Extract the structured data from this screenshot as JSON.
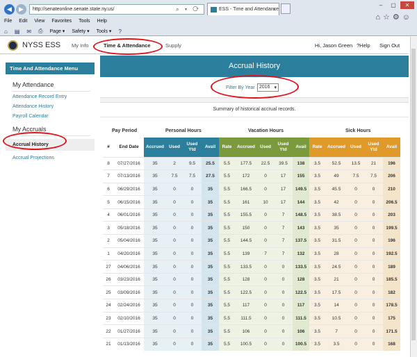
{
  "browser": {
    "url": "http://senateonline.senate.state.ny.us/",
    "tab_title": "ESS - Time and Attendance",
    "menu": [
      "File",
      "Edit",
      "View",
      "Favorites",
      "Tools",
      "Help"
    ],
    "commands": [
      "Page ▾",
      "Safety ▾",
      "Tools ▾"
    ]
  },
  "app": {
    "brand": "NYSS ESS",
    "nav": {
      "my_info": "My Info",
      "time_attendance": "Time & Attendance",
      "supply": "Supply"
    },
    "user_greeting": "Hi, Jason Green",
    "help": "Help",
    "sign_out": "Sign Out"
  },
  "sidebar": {
    "header": "Time And Attendance Menu",
    "section1": "My Attendance",
    "items1": [
      "Attendance Record Entry",
      "Attendance History",
      "Payroll Calendar"
    ],
    "section2": "My Accruals",
    "items2": [
      "Accrual History",
      "Accrual Projections"
    ]
  },
  "page": {
    "title": "Accrual History",
    "filter_label": "Filter By Year",
    "filter_value": "2016",
    "summary": "Summary of historical accrual records."
  },
  "table": {
    "group_headers": {
      "pay_period": "Pay Period",
      "personal": "Personal Hours",
      "vacation": "Vacation Hours",
      "sick": "Sick Hours"
    },
    "columns": [
      "#",
      "End Date",
      "Accrued",
      "Used",
      "Used Ytd",
      "Avail",
      "Rate",
      "Accrued",
      "Used",
      "Used Ytd",
      "Avail",
      "Rate",
      "Accrued",
      "Used",
      "Used Ytd",
      "Avail"
    ],
    "rows": [
      [
        "8",
        "07/27/2016",
        "35",
        "2",
        "9.5",
        "25.5",
        "5.5",
        "177.5",
        "22.5",
        "39.5",
        "138",
        "3.5",
        "52.5",
        "13.5",
        "21",
        "196"
      ],
      [
        "7",
        "07/13/2016",
        "35",
        "7.5",
        "7.5",
        "27.5",
        "5.5",
        "172",
        "0",
        "17",
        "155",
        "3.5",
        "49",
        "7.5",
        "7.5",
        "206"
      ],
      [
        "6",
        "06/29/2016",
        "35",
        "0",
        "0",
        "35",
        "5.5",
        "166.5",
        "0",
        "17",
        "149.5",
        "3.5",
        "45.5",
        "0",
        "0",
        "210"
      ],
      [
        "5",
        "06/15/2016",
        "35",
        "0",
        "0",
        "35",
        "5.5",
        "161",
        "10",
        "17",
        "144",
        "3.5",
        "42",
        "0",
        "0",
        "206.5"
      ],
      [
        "4",
        "06/01/2016",
        "35",
        "0",
        "0",
        "35",
        "5.5",
        "155.5",
        "0",
        "7",
        "148.5",
        "3.5",
        "38.5",
        "0",
        "0",
        "203"
      ],
      [
        "3",
        "05/18/2016",
        "35",
        "0",
        "0",
        "35",
        "5.5",
        "150",
        "0",
        "7",
        "143",
        "3.5",
        "35",
        "0",
        "0",
        "199.5"
      ],
      [
        "2",
        "05/04/2016",
        "35",
        "0",
        "0",
        "35",
        "5.5",
        "144.5",
        "0",
        "7",
        "137.5",
        "3.5",
        "31.5",
        "0",
        "0",
        "196"
      ],
      [
        "1",
        "04/20/2016",
        "35",
        "0",
        "0",
        "35",
        "5.5",
        "139",
        "7",
        "7",
        "132",
        "3.5",
        "28",
        "0",
        "0",
        "192.5"
      ],
      [
        "27",
        "04/06/2016",
        "35",
        "0",
        "0",
        "35",
        "5.5",
        "133.5",
        "0",
        "0",
        "133.5",
        "3.5",
        "24.5",
        "0",
        "0",
        "189"
      ],
      [
        "26",
        "03/23/2016",
        "35",
        "0",
        "0",
        "35",
        "5.5",
        "128",
        "0",
        "0",
        "128",
        "3.5",
        "21",
        "0",
        "0",
        "185.5"
      ],
      [
        "25",
        "03/09/2016",
        "35",
        "0",
        "0",
        "35",
        "5.5",
        "122.5",
        "0",
        "0",
        "122.5",
        "3.5",
        "17.5",
        "0",
        "0",
        "182"
      ],
      [
        "24",
        "02/24/2016",
        "35",
        "0",
        "0",
        "35",
        "5.5",
        "117",
        "0",
        "0",
        "117",
        "3.5",
        "14",
        "0",
        "0",
        "178.5"
      ],
      [
        "23",
        "02/10/2016",
        "35",
        "0",
        "0",
        "35",
        "5.5",
        "111.5",
        "0",
        "0",
        "111.5",
        "3.5",
        "10.5",
        "0",
        "0",
        "175"
      ],
      [
        "22",
        "01/27/2016",
        "35",
        "0",
        "0",
        "35",
        "5.5",
        "106",
        "0",
        "0",
        "106",
        "3.5",
        "7",
        "0",
        "0",
        "171.5"
      ],
      [
        "21",
        "01/13/2016",
        "35",
        "0",
        "0",
        "35",
        "5.5",
        "100.5",
        "0",
        "0",
        "100.5",
        "3.5",
        "3.5",
        "0",
        "0",
        "168"
      ]
    ]
  },
  "colors": {
    "teal": "#2b7e9c",
    "green": "#7a9a3c",
    "orange": "#e09a2a",
    "annotation": "#e0141b"
  }
}
